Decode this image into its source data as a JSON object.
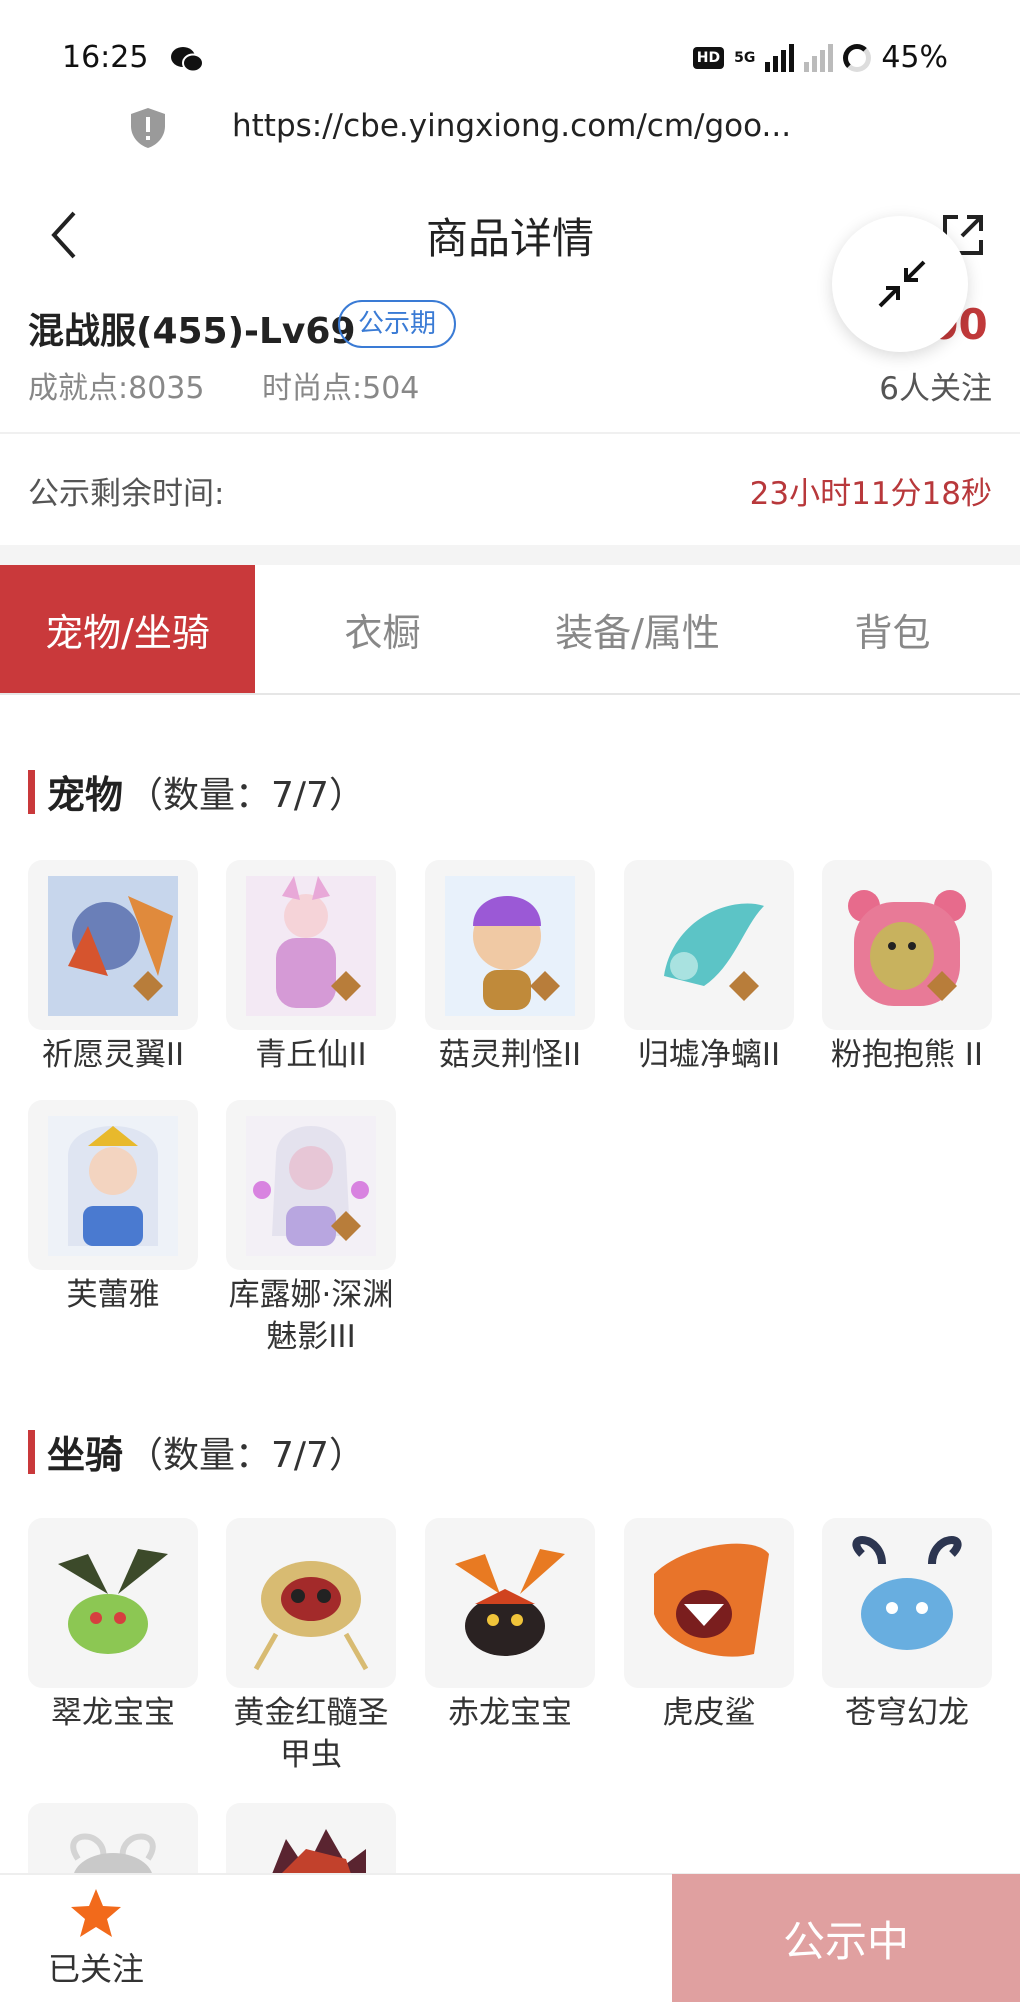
{
  "status_bar": {
    "time": "16:25",
    "network": "5G",
    "battery": "45%"
  },
  "url_bar": {
    "url": "https://cbe.yingxiong.com/cm/goo..."
  },
  "header": {
    "title": "商品详情"
  },
  "item": {
    "title": "混战服(455)-Lv69",
    "badge": "公示期",
    "price": "200",
    "achievements": "成就点:8035",
    "fashion": "时尚点:504",
    "follow_count": "6人关注"
  },
  "countdown": {
    "label": "公示剩余时间:",
    "value": "23小时11分18秒"
  },
  "tabs": [
    "宠物/坐骑",
    "衣橱",
    "装备/属性",
    "背包"
  ],
  "pets": {
    "title": "宠物",
    "count": "（数量：7/7）",
    "items": [
      "祈愿灵翼II",
      "青丘仙II",
      "菇灵荆怪II",
      "归墟净螭II",
      "粉抱抱熊 II",
      "芙蕾雅",
      "库露娜·深渊魅影III"
    ]
  },
  "mounts": {
    "title": "坐骑",
    "count": "（数量：7/7）",
    "items": [
      "翠龙宝宝",
      "黄金红髓圣甲虫",
      "赤龙宝宝",
      "虎皮鲨",
      "苍穹幻龙",
      "",
      ""
    ]
  },
  "bottom_bar": {
    "followed_label": "已关注",
    "cta": "公示中"
  },
  "colors": {
    "accent": "#c9393b",
    "cta_bg": "#e0a0a0",
    "badge": "#3a7bd5",
    "star": "#f26a1b"
  }
}
